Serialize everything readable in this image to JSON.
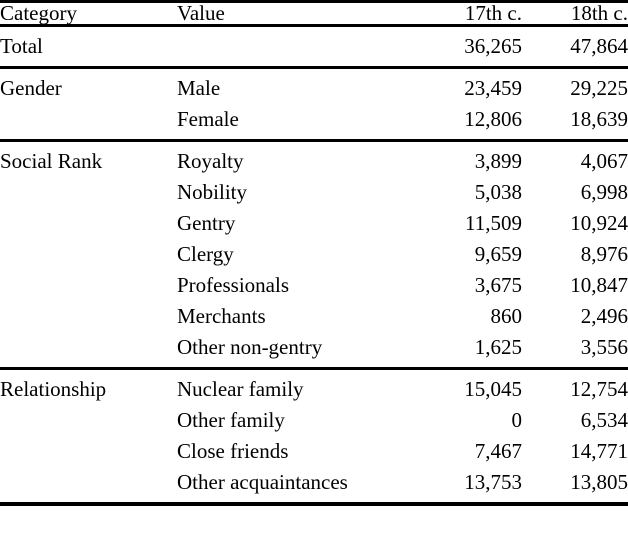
{
  "table": {
    "columns": [
      {
        "key": "category",
        "label": "Category",
        "align": "left"
      },
      {
        "key": "value",
        "label": "Value",
        "align": "left"
      },
      {
        "key": "c17",
        "label": "17th c.",
        "align": "right"
      },
      {
        "key": "c18",
        "label": "18th c.",
        "align": "right"
      }
    ],
    "sections": [
      {
        "name": "total",
        "rows": [
          {
            "category": "Total",
            "value": "",
            "c17": "36,265",
            "c18": "47,864"
          }
        ]
      },
      {
        "name": "gender",
        "rows": [
          {
            "category": "Gender",
            "value": "Male",
            "c17": "23,459",
            "c18": "29,225"
          },
          {
            "category": "",
            "value": "Female",
            "c17": "12,806",
            "c18": "18,639"
          }
        ]
      },
      {
        "name": "social-rank",
        "rows": [
          {
            "category": "Social Rank",
            "value": "Royalty",
            "c17": "3,899",
            "c18": "4,067"
          },
          {
            "category": "",
            "value": "Nobility",
            "c17": "5,038",
            "c18": "6,998"
          },
          {
            "category": "",
            "value": "Gentry",
            "c17": "11,509",
            "c18": "10,924"
          },
          {
            "category": "",
            "value": "Clergy",
            "c17": "9,659",
            "c18": "8,976"
          },
          {
            "category": "",
            "value": "Professionals",
            "c17": "3,675",
            "c18": "10,847"
          },
          {
            "category": "",
            "value": "Merchants",
            "c17": "860",
            "c18": "2,496"
          },
          {
            "category": "",
            "value": "Other non-gentry",
            "c17": "1,625",
            "c18": "3,556"
          }
        ]
      },
      {
        "name": "relationship",
        "rows": [
          {
            "category": "Relationship",
            "value": "Nuclear family",
            "c17": "15,045",
            "c18": "12,754"
          },
          {
            "category": "",
            "value": "Other family",
            "c17": "0",
            "c18": "6,534"
          },
          {
            "category": "",
            "value": "Close friends",
            "c17": "7,467",
            "c18": "14,771"
          },
          {
            "category": "",
            "value": "Other acquaintances",
            "c17": "13,753",
            "c18": "13,805"
          }
        ]
      }
    ],
    "colors": {
      "text": "#000000",
      "background": "#ffffff",
      "rule": "#000000"
    }
  }
}
